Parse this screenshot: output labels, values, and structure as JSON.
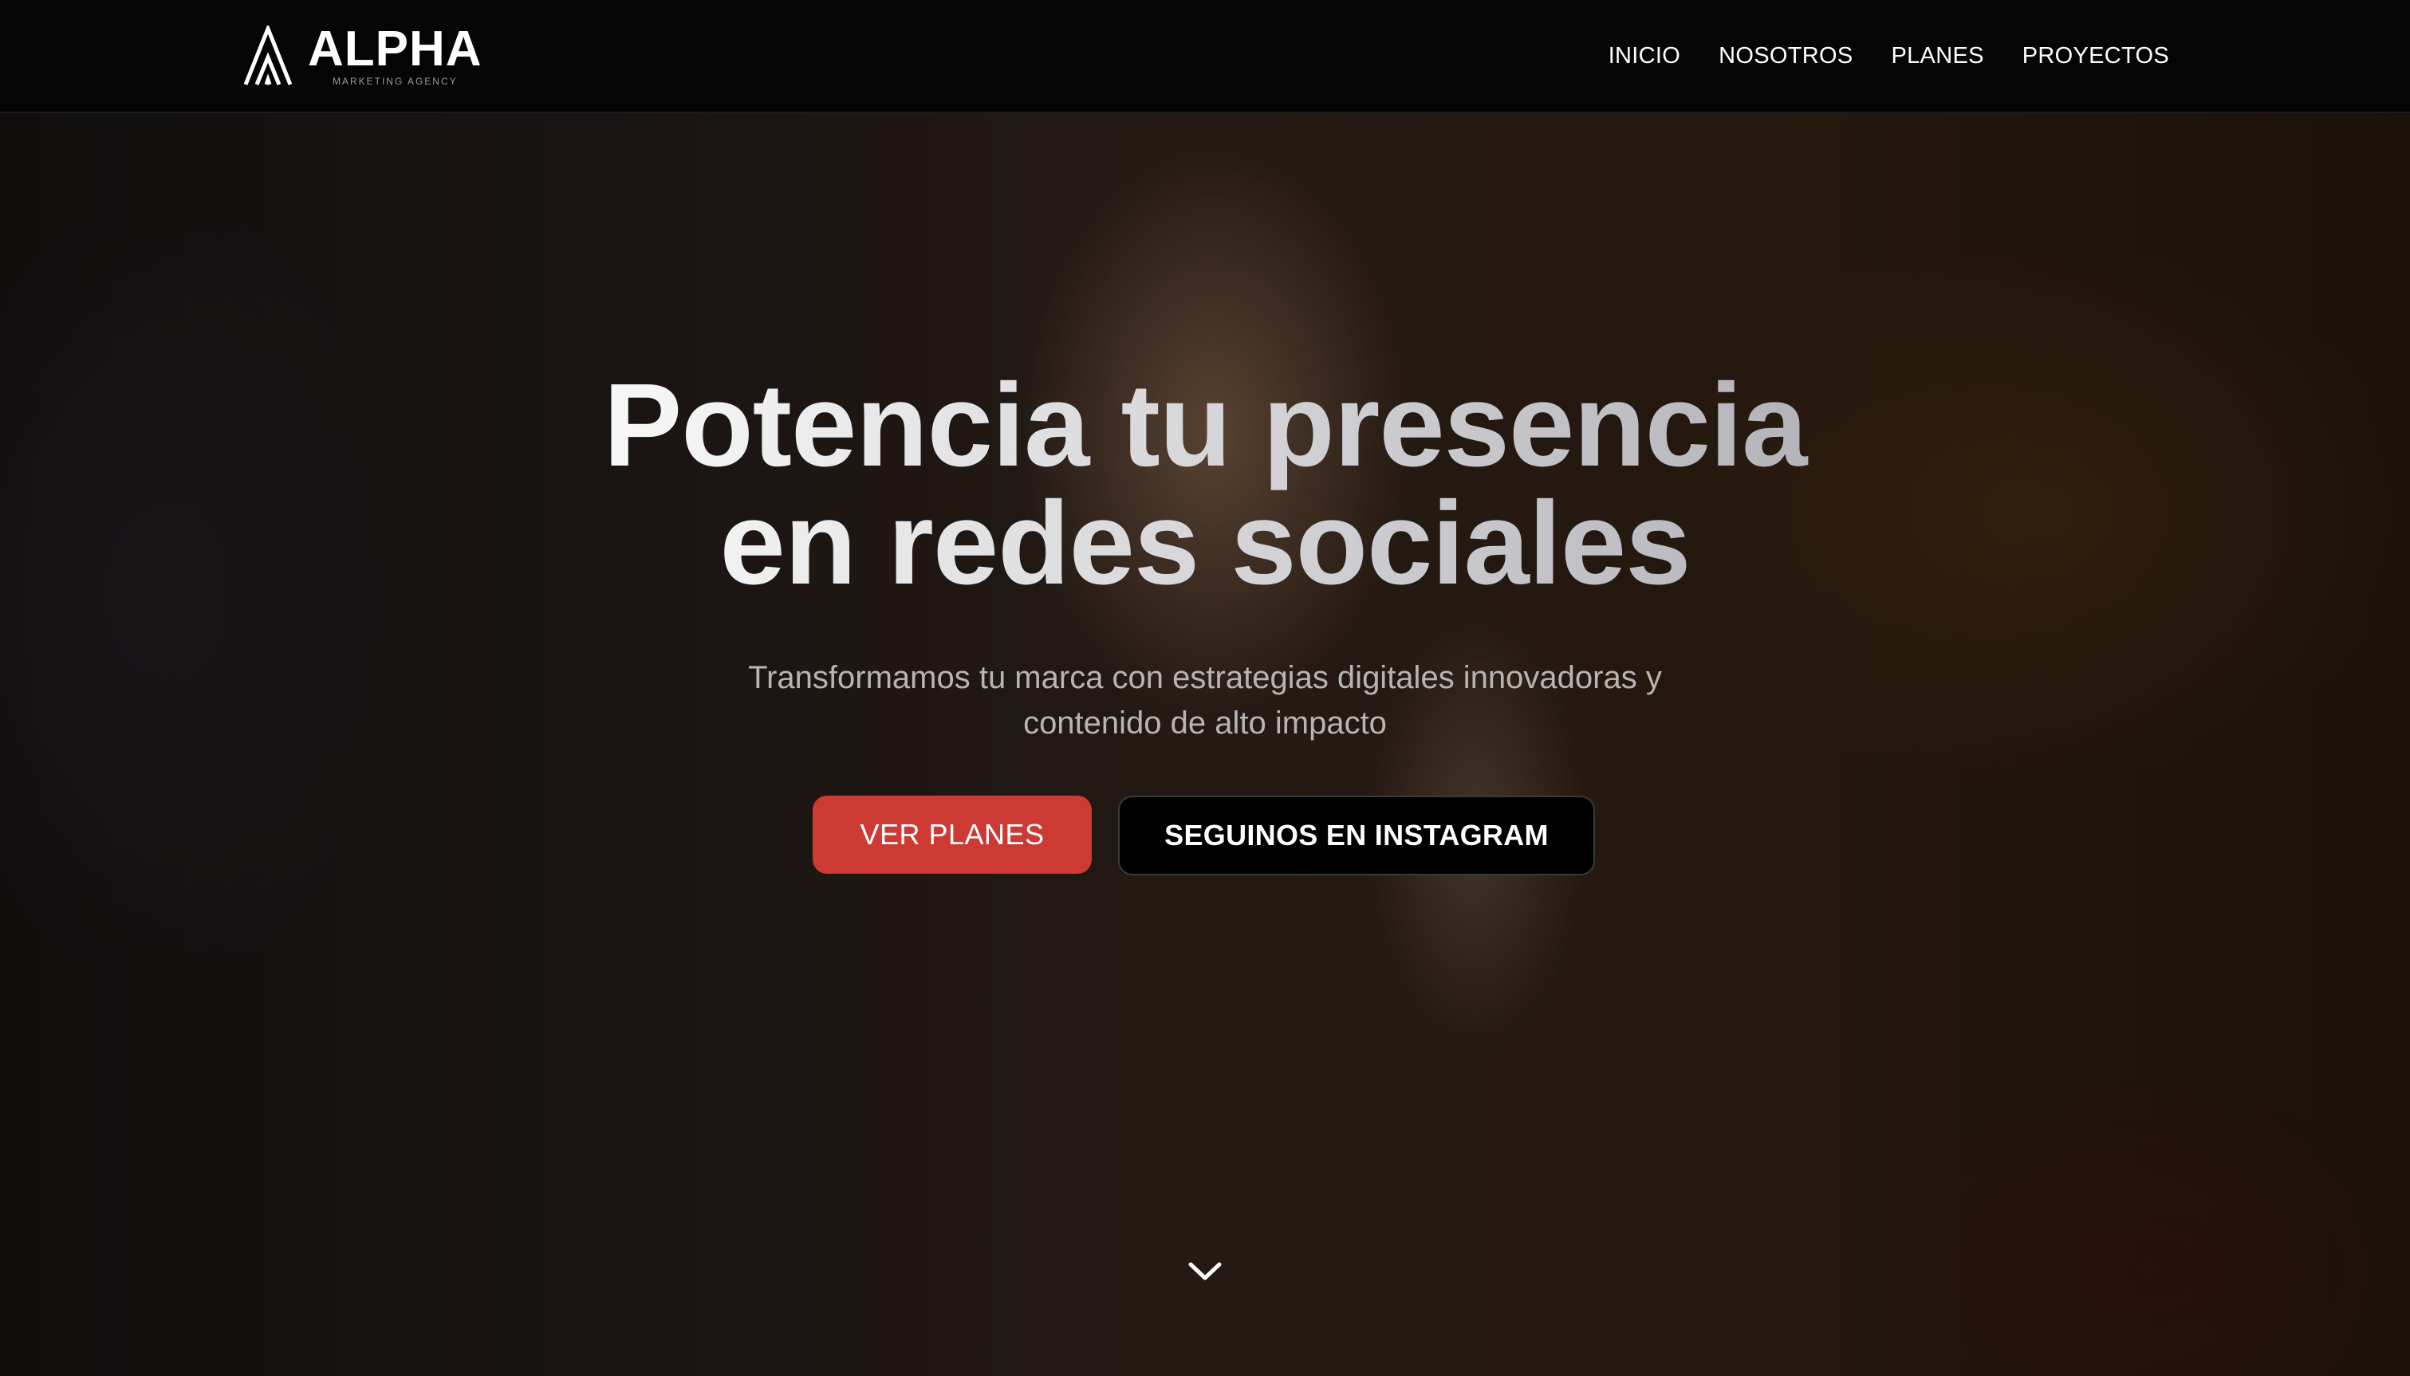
{
  "brand": {
    "name": "ALPHA",
    "tagline": "MARKETING AGENCY"
  },
  "nav": {
    "items": [
      {
        "label": "INICIO"
      },
      {
        "label": "NOSOTROS"
      },
      {
        "label": "PLANES"
      },
      {
        "label": "PROYECTOS"
      }
    ]
  },
  "hero": {
    "headline_line1": "Potencia tu presencia",
    "headline_line2": "en redes sociales",
    "subtitle": "Transformamos tu marca con estrategias digitales innovadoras y contenido de alto impacto",
    "primary_button": "VER PLANES",
    "secondary_button": "SEGUINOS EN INSTAGRAM",
    "scroll_icon": "chevron-down-icon"
  },
  "colors": {
    "navbar_bg": "#050505",
    "primary_button_bg": "#cc3a33",
    "secondary_button_bg": "#000000",
    "text": "#ffffff",
    "subtitle": "#b7b5b4"
  }
}
